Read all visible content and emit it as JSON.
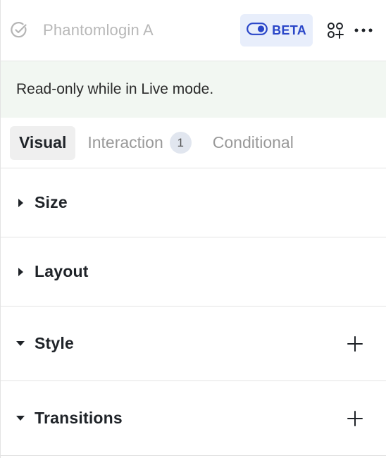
{
  "header": {
    "title": "Phantomlogin A",
    "beta_label": "BETA",
    "icons": [
      "check-circle-icon",
      "toggle-icon",
      "components-add-icon",
      "more-icon"
    ]
  },
  "notice": {
    "text": "Read-only while in Live mode."
  },
  "tabs": [
    {
      "label": "Visual",
      "active": true
    },
    {
      "label": "Interaction",
      "badge": "1"
    },
    {
      "label": "Conditional"
    }
  ],
  "sections": [
    {
      "label": "Size",
      "expanded": false
    },
    {
      "label": "Layout",
      "expanded": false
    },
    {
      "label": "Style",
      "expanded": true,
      "add_icon": "plus-icon"
    },
    {
      "label": "Transitions",
      "expanded": true,
      "add_icon": "plus-icon"
    }
  ],
  "colors": {
    "accent": "#2a46c8",
    "beta_bg": "#e8eefb",
    "notice_bg": "#f2f7f2"
  }
}
